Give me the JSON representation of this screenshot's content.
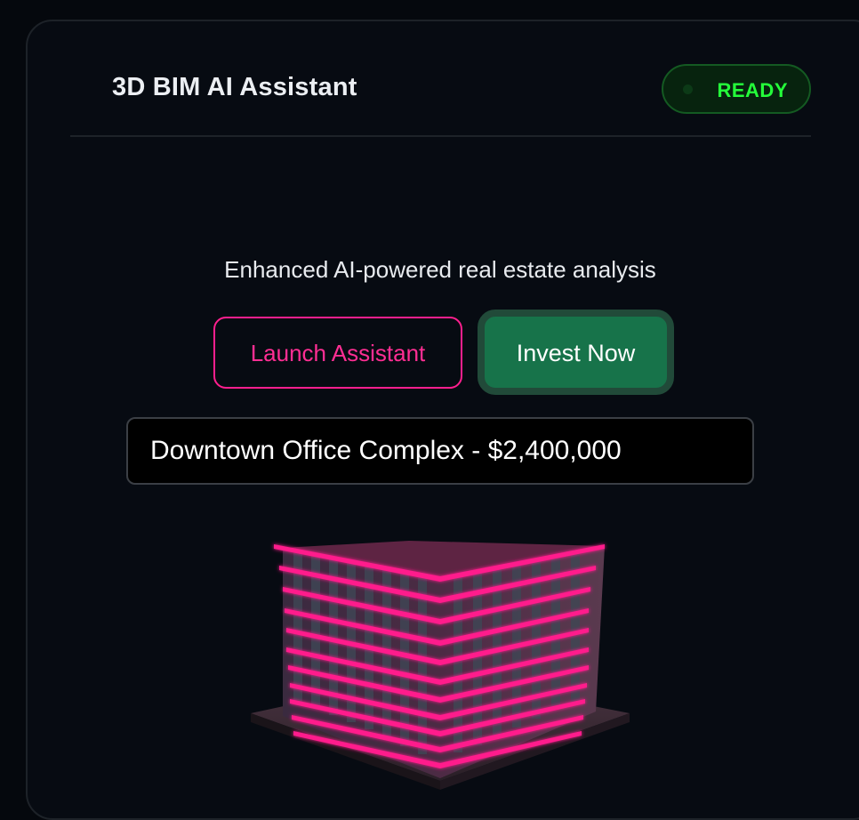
{
  "header": {
    "title": "3D BIM AI Assistant",
    "status": "READY"
  },
  "main": {
    "subtitle": "Enhanced AI-powered real estate analysis",
    "launch_button": "Launch Assistant",
    "invest_button": "Invest Now",
    "property_value": "Downtown Office Complex - $2,400,000"
  },
  "colors": {
    "background": "#070b12",
    "accent_pink": "#ff1f8e",
    "accent_green": "#17734a",
    "status_green": "#24ff3a"
  },
  "icons": {
    "model": "building-3d-icon"
  }
}
